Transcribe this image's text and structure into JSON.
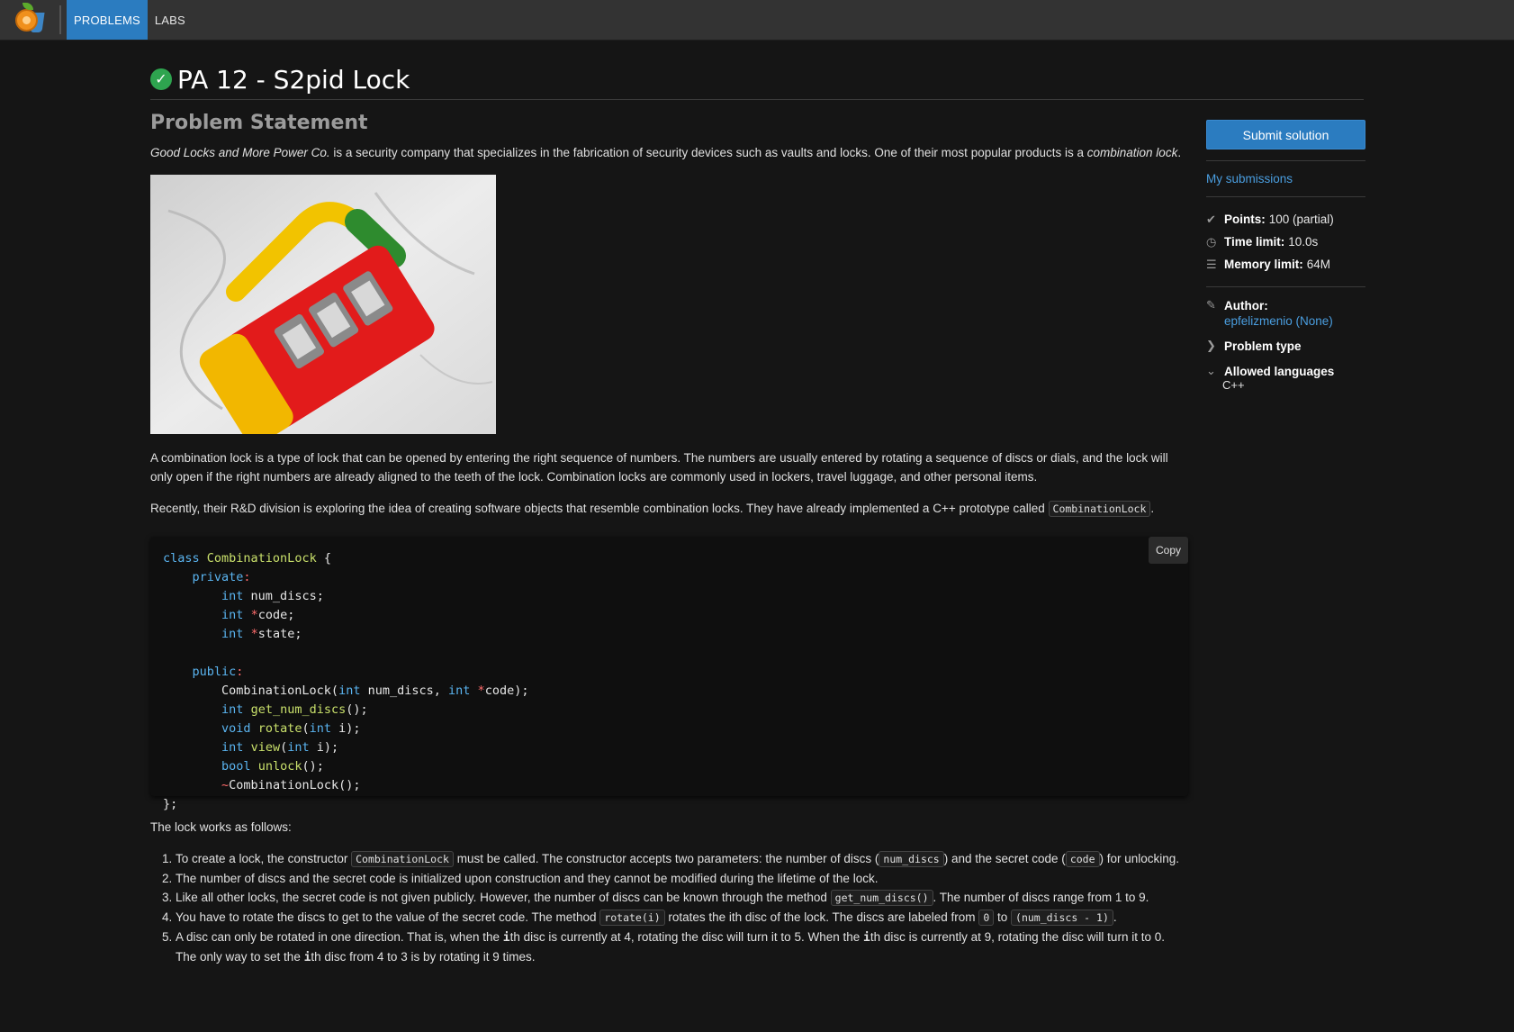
{
  "nav": {
    "items": [
      {
        "label": "PROBLEMS",
        "active": true
      },
      {
        "label": "LABS",
        "active": false
      }
    ]
  },
  "problem": {
    "title": "PA 12 - S2pid Lock",
    "section_title": "Problem Statement",
    "intro_company": "Good Locks and More Power Co.",
    "intro_text": " is a security company that specializes in the fabrication of security devices such as vaults and locks. One of their most popular products is a ",
    "intro_product": "combination lock",
    "intro_end": ".",
    "para1": "A combination lock is a type of lock that can be opened by entering the right sequence of numbers. The numbers are usually entered by rotating a sequence of discs or dials, and the lock will only open if the right numbers are already aligned to the teeth of the lock. Combination locks are commonly used in lockers, travel luggage, and other personal items.",
    "para2_text": "Recently, their R&D division is exploring the idea of creating software objects that resemble combination locks. They have already implemented a C++ prototype called ",
    "para2_code": "CombinationLock",
    "para2_end": ".",
    "copy_label": "Copy",
    "works_text": "The lock works as follows:",
    "rules": {
      "r1_a": "To create a lock, the constructor ",
      "r1_code1": "CombinationLock",
      "r1_b": " must be called. The constructor accepts two parameters: the number of discs (",
      "r1_code2": "num_discs",
      "r1_c": ") and the secret code (",
      "r1_code3": "code",
      "r1_d": ") for unlocking.",
      "r2": "The number of discs and the secret code is initialized upon construction and they cannot be modified during the lifetime of the lock.",
      "r3_a": "Like all other locks, the secret code is not given publicly. However, the number of discs can be known through the method ",
      "r3_code": "get_num_discs()",
      "r3_b": ". The number of discs range from 1 to 9.",
      "r4_a": "You have to rotate the discs to get to the value of the secret code. The method ",
      "r4_code1": "rotate(i)",
      "r4_b": " rotates the ith disc of the lock. The discs are labeled from ",
      "r4_code2": "0",
      "r4_c": " to ",
      "r4_code3": "(num_discs - 1)",
      "r4_d": ".",
      "r5_a": "A disc can only be rotated in one direction. That is, when the ",
      "r5_i1": "i",
      "r5_b": "th disc is currently at 4, rotating the disc will turn it to 5. When the ",
      "r5_i2": "i",
      "r5_c": "th disc is currently at 9, rotating the disc will turn it to 0. The only way to set the ",
      "r5_i3": "i",
      "r5_d": "th disc from 4 to 3 is by rotating it 9 times."
    }
  },
  "sidebar": {
    "submit_label": "Submit solution",
    "submissions_label": "My submissions",
    "points_label": "Points:",
    "points_value": "100 (partial)",
    "time_label": "Time limit:",
    "time_value": "10.0s",
    "memory_label": "Memory limit:",
    "memory_value": "64M",
    "author_label": "Author:",
    "author_value": "epfelizmenio (None)",
    "problem_type_label": "Problem type",
    "languages_label": "Allowed languages",
    "languages_value": "C++"
  },
  "colors": {
    "accent": "#2b7cc0",
    "link": "#4a9ee0",
    "success": "#2ea44f",
    "background": "#151515"
  }
}
